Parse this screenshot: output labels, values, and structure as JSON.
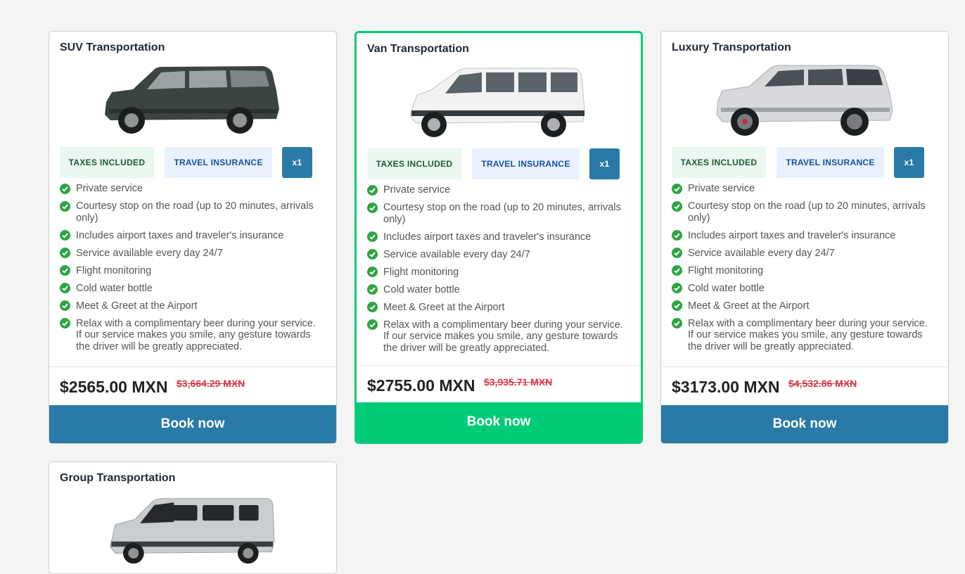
{
  "cards": [
    {
      "title": "SUV Transportation",
      "badge_taxes": "TAXES INCLUDED",
      "badge_insurance": "TRAVEL INSURANCE",
      "badge_qty": "x1",
      "features": [
        "Private service",
        "Courtesy stop on the road (up to 20 minutes, arrivals only)",
        "Includes airport taxes and traveler's insurance",
        "Service available every day 24/7",
        "Flight monitoring",
        "Cold water bottle",
        "Meet & Greet at the Airport",
        "Relax with a complimentary beer during your service. If our service makes you smile, any gesture towards the driver will be greatly appreciated."
      ],
      "price": "$2565.00 MXN",
      "old_price": "$3,664.29 MXN",
      "book_label": "Book now",
      "vehicle_color": "#3b4441"
    },
    {
      "title": "Van Transportation",
      "badge_taxes": "TAXES INCLUDED",
      "badge_insurance": "TRAVEL INSURANCE",
      "badge_qty": "x1",
      "features": [
        "Private service",
        "Courtesy stop on the road (up to 20 minutes, arrivals only)",
        "Includes airport taxes and traveler's insurance",
        "Service available every day 24/7",
        "Flight monitoring",
        "Cold water bottle",
        "Meet & Greet at the Airport",
        "Relax with a complimentary beer during your service. If our service makes you smile, any gesture towards the driver will be greatly appreciated."
      ],
      "price": "$2755.00 MXN",
      "old_price": "$3,935.71 MXN",
      "book_label": "Book now",
      "vehicle_color": "#f2f2f2"
    },
    {
      "title": "Luxury Transportation",
      "badge_taxes": "TAXES INCLUDED",
      "badge_insurance": "TRAVEL INSURANCE",
      "badge_qty": "x1",
      "features": [
        "Private service",
        "Courtesy stop on the road (up to 20 minutes, arrivals only)",
        "Includes airport taxes and traveler's insurance",
        "Service available every day 24/7",
        "Flight monitoring",
        "Cold water bottle",
        "Meet & Greet at the Airport",
        "Relax with a complimentary beer during your service. If our service makes you smile, any gesture towards the driver will be greatly appreciated."
      ],
      "price": "$3173.00 MXN",
      "old_price": "$4,532.86 MXN",
      "book_label": "Book now",
      "vehicle_color": "#d8d9dc"
    },
    {
      "title": "Group Transportation",
      "vehicle_color": "#c9ccd1"
    }
  ],
  "colors": {
    "primary": "#2a7aa8",
    "featured": "#00cc77",
    "check": "#2ea443",
    "strike": "#d33b4a"
  }
}
